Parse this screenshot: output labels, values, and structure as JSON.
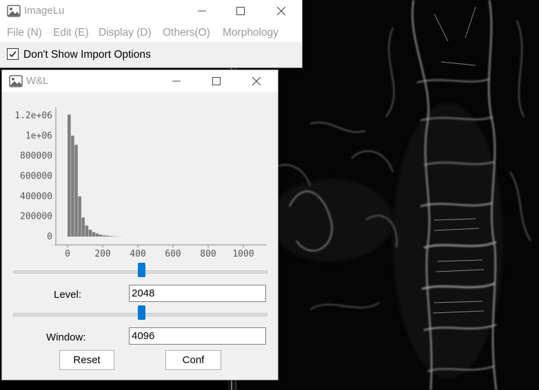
{
  "main_window": {
    "title": "ImageLu",
    "menu": [
      "File (N)",
      "Edit (E)",
      "Display (D)",
      "Others(O)",
      "Morphology"
    ],
    "option_label": "Don't Show Import Options",
    "option_checked": true
  },
  "wl_window": {
    "title": "W&L",
    "histogram": {
      "type": "bar",
      "y_ticks": [
        "1.2e+06",
        "1e+06",
        "800000",
        "600000",
        "400000",
        "200000",
        "0"
      ],
      "x_ticks": [
        "0",
        "200",
        "400",
        "600",
        "800",
        "1000"
      ],
      "xlim": [
        0,
        1050
      ],
      "ylim": [
        0,
        1200000
      ],
      "bin_width": 20,
      "bins": [
        0,
        20,
        40,
        60,
        80,
        100,
        120,
        140,
        160,
        180,
        200,
        220,
        240,
        260,
        280,
        300
      ],
      "counts": [
        1210000,
        1000000,
        910000,
        400000,
        190000,
        110000,
        70000,
        45000,
        30000,
        20000,
        12000,
        8000,
        5000,
        3000,
        2000,
        1000
      ]
    },
    "level_label": "Level:",
    "level_value": "2048",
    "level_slider_fraction": 0.5,
    "window_label": "Window:",
    "window_value": "4096",
    "window_slider_fraction": 0.5,
    "reset_label": "Reset",
    "conf_label": "Conf"
  },
  "colors": {
    "slider_thumb": "#0078d7",
    "histogram_bar": "#7f7f7f",
    "window_bg": "#f0f0f0"
  },
  "chart_data": {
    "type": "bar",
    "x": [
      0,
      20,
      40,
      60,
      80,
      100,
      120,
      140,
      160,
      180,
      200,
      220,
      240,
      260,
      280,
      300
    ],
    "values": [
      1210000,
      1000000,
      910000,
      400000,
      190000,
      110000,
      70000,
      45000,
      30000,
      20000,
      12000,
      8000,
      5000,
      3000,
      2000,
      1000
    ],
    "title": "",
    "xlabel": "",
    "ylabel": "",
    "xlim": [
      0,
      1050
    ],
    "ylim": [
      0,
      1200000
    ],
    "grid": false
  }
}
